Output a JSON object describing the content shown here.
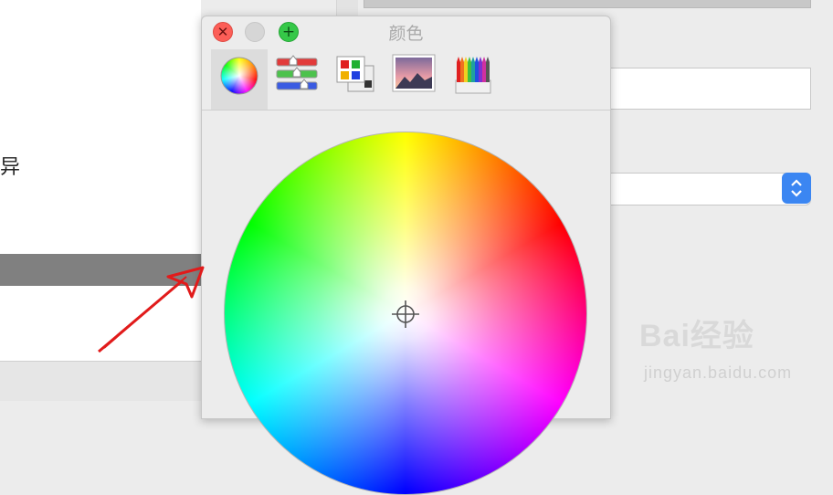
{
  "background": {
    "left_char": "异"
  },
  "panel": {
    "title": "颜色",
    "close_glyph": "✕",
    "zoom_glyph": "+",
    "tools": [
      {
        "name": "color-wheel"
      },
      {
        "name": "color-sliders"
      },
      {
        "name": "color-palettes"
      },
      {
        "name": "image-palettes"
      },
      {
        "name": "pencils"
      }
    ]
  },
  "watermark": {
    "brand": "Bai经验",
    "url": "jingyan.baidu.com"
  }
}
